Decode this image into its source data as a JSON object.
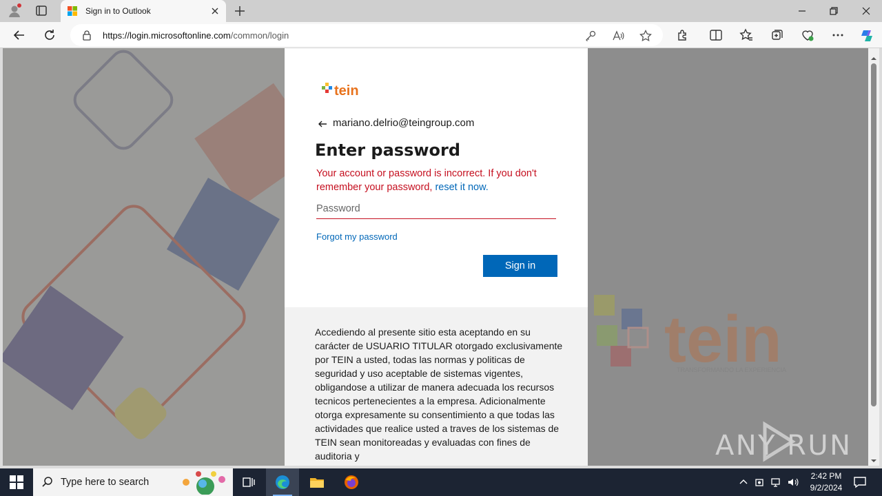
{
  "browser": {
    "tab_title": "Sign in to Outlook",
    "url_host": "https://login.microsoftonline.com",
    "url_path": "/common/login"
  },
  "login": {
    "brand": "tein",
    "identity": "mariano.delrio@teingroup.com",
    "heading": "Enter password",
    "error_text": "Your account or password is incorrect. If you don't remember your password, ",
    "error_link": "reset it now.",
    "password_value": "",
    "password_placeholder": "Password",
    "forgot_link": "Forgot my password",
    "signin_label": "Sign in",
    "notice_text": "Accediendo al presente sitio esta aceptando en su carácter de USUARIO TITULAR otorgado exclusivamente por TEIN a usted, todas las normas y politicas de seguridad y uso aceptable de sistemas vigentes, obligandose a utilizar de manera adecuada los recursos tecnicos pertenecientes a la empresa. Adicionalmente otorga expresamente su consentimiento a que todas las actividades que realice usted a traves de los sistemas de TEIN sean monitoreadas y evaluadas con fines de auditoria y"
  },
  "background": {
    "brand_large": "tein",
    "tagline": "TRANSFORMANDO LA EXPERIENCIA"
  },
  "watermark": {
    "text": "ANY RUN"
  },
  "taskbar": {
    "search_placeholder": "Type here to search",
    "time": "2:42 PM",
    "date": "9/2/2024"
  },
  "colors": {
    "accent": "#0067b8",
    "error": "#c50f1f",
    "taskbar": "#1c2433"
  }
}
